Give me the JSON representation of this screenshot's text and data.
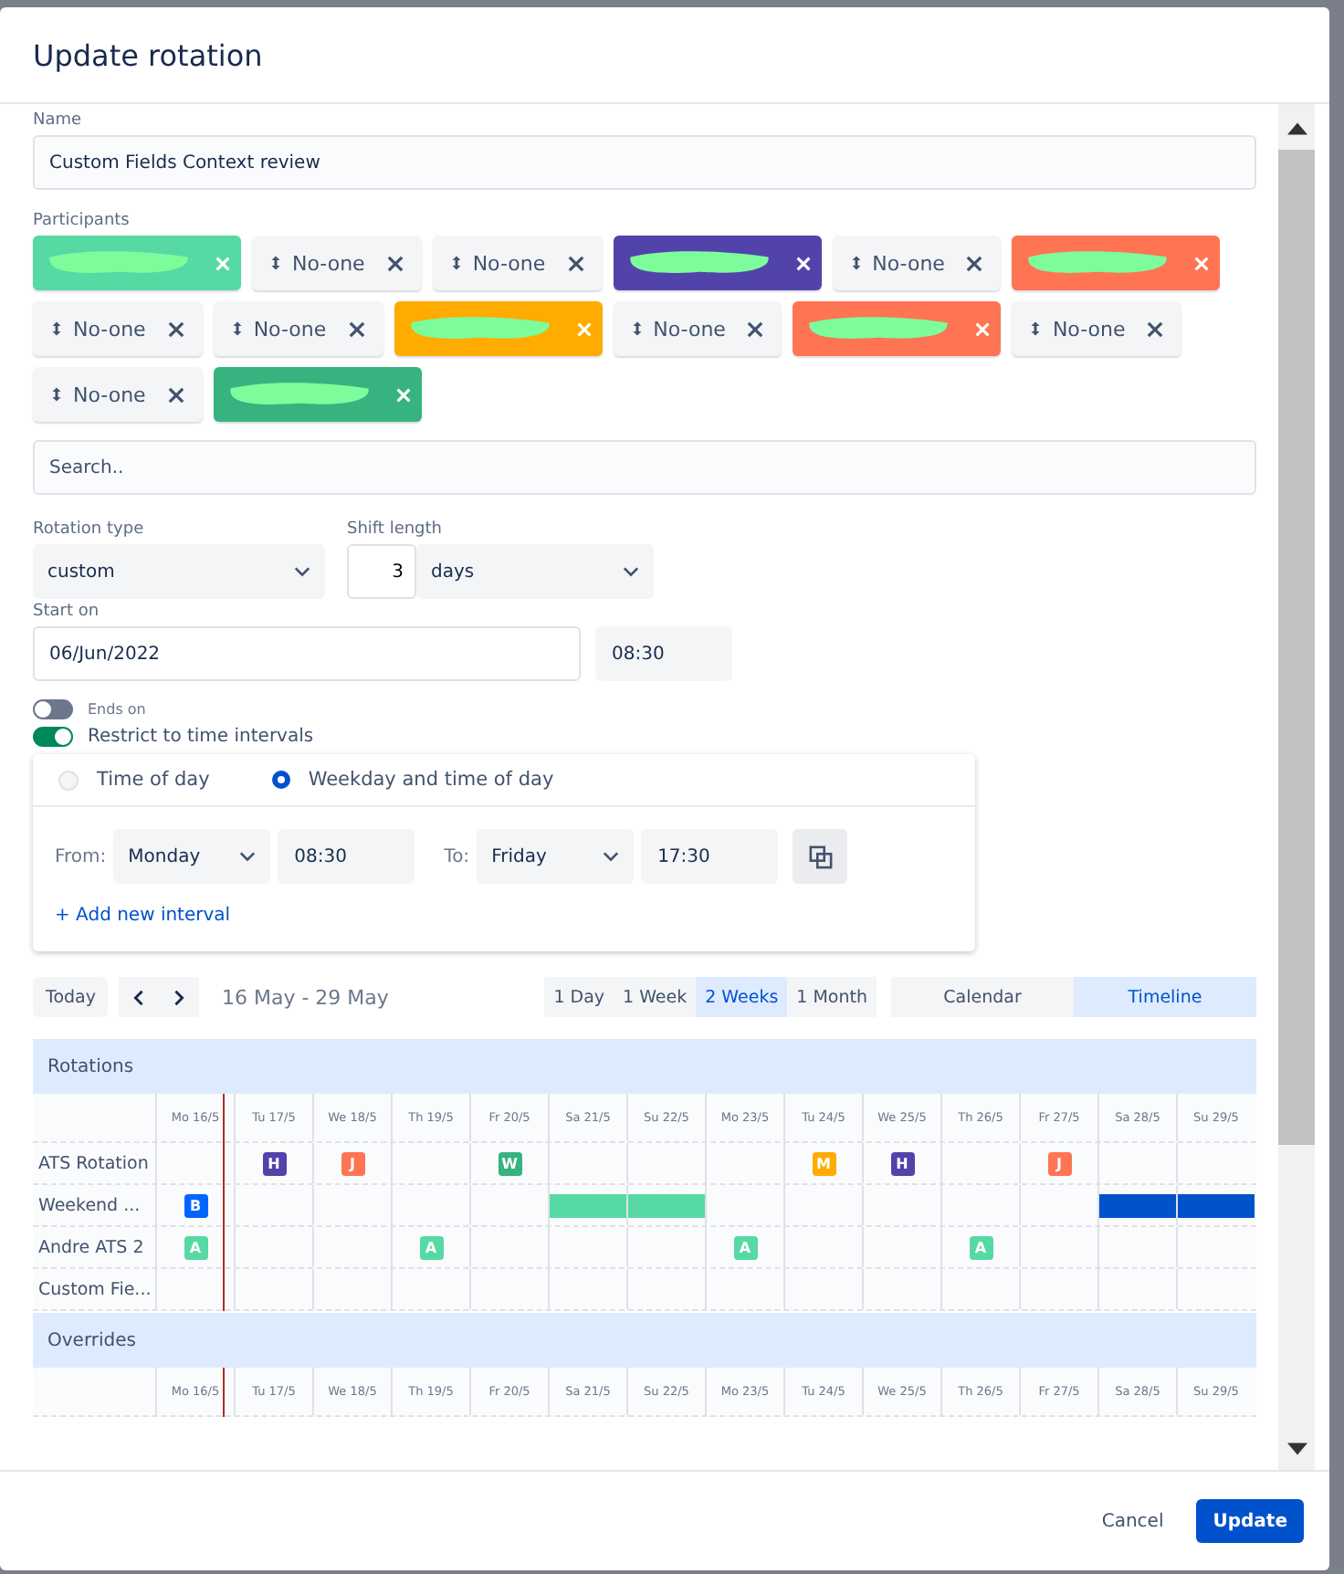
{
  "dialog": {
    "title": "Update rotation"
  },
  "name": {
    "label": "Name",
    "value": "Custom Fields Context review"
  },
  "participants": {
    "label": "Participants",
    "items": [
      {
        "kind": "redacted",
        "color": "#57d9a3"
      },
      {
        "kind": "empty",
        "label": "No-one"
      },
      {
        "kind": "empty",
        "label": "No-one"
      },
      {
        "kind": "redacted",
        "color": "#5243aa"
      },
      {
        "kind": "empty",
        "label": "No-one"
      },
      {
        "kind": "redacted",
        "color": "#ff7452"
      },
      {
        "kind": "empty",
        "label": "No-one"
      },
      {
        "kind": "empty",
        "label": "No-one"
      },
      {
        "kind": "redacted",
        "color": "#ffab00"
      },
      {
        "kind": "empty",
        "label": "No-one"
      },
      {
        "kind": "redacted",
        "color": "#ff7452"
      },
      {
        "kind": "empty",
        "label": "No-one"
      },
      {
        "kind": "empty",
        "label": "No-one"
      },
      {
        "kind": "redacted",
        "color": "#36b37e"
      }
    ],
    "search_placeholder": "Search.."
  },
  "rotation_type": {
    "label": "Rotation type",
    "value": "custom"
  },
  "shift_length": {
    "label": "Shift length",
    "count": "3",
    "unit": "days"
  },
  "start_on": {
    "label": "Start on",
    "date": "06/Jun/2022",
    "time": "08:30"
  },
  "ends_on": {
    "label": "Ends on",
    "on": false
  },
  "restrict": {
    "label": "Restrict to time intervals",
    "on": true,
    "modes": [
      {
        "label": "Time of day",
        "selected": false
      },
      {
        "label": "Weekday and time of day",
        "selected": true
      }
    ],
    "interval": {
      "from_label": "From:",
      "from_day": "Monday",
      "from_time": "08:30",
      "to_label": "To:",
      "to_day": "Friday",
      "to_time": "17:30"
    },
    "add_link": "+ Add new interval"
  },
  "calendar": {
    "today": "Today",
    "range": "16 May - 29 May",
    "spans": [
      {
        "label": "1 Day",
        "selected": false
      },
      {
        "label": "1 Week",
        "selected": false
      },
      {
        "label": "2 Weeks",
        "selected": true
      },
      {
        "label": "1 Month",
        "selected": false
      }
    ],
    "views": [
      {
        "label": "Calendar",
        "selected": false
      },
      {
        "label": "Timeline",
        "selected": true
      }
    ],
    "days": [
      "Mo 16/5",
      "Tu 17/5",
      "We 18/5",
      "Th 19/5",
      "Fr 20/5",
      "Sa 21/5",
      "Su 22/5",
      "Mo 23/5",
      "Tu 24/5",
      "We 25/5",
      "Th 26/5",
      "Fr 27/5",
      "Sa 28/5",
      "Su 29/5"
    ],
    "rotations_title": "Rotations",
    "rows": [
      {
        "name": "ATS Rotation",
        "cells": [
          {
            "kind": "empty"
          },
          {
            "kind": "badge",
            "letter": "H",
            "color": "#5243aa"
          },
          {
            "kind": "badge",
            "letter": "J",
            "color": "#ff7452"
          },
          {
            "kind": "empty"
          },
          {
            "kind": "badge",
            "letter": "W",
            "color": "#36b37e"
          },
          {
            "kind": "empty"
          },
          {
            "kind": "empty"
          },
          {
            "kind": "empty"
          },
          {
            "kind": "badge",
            "letter": "M",
            "color": "#ffab00"
          },
          {
            "kind": "badge",
            "letter": "H",
            "color": "#5243aa"
          },
          {
            "kind": "empty"
          },
          {
            "kind": "badge",
            "letter": "J",
            "color": "#ff7452"
          },
          {
            "kind": "empty"
          },
          {
            "kind": "empty"
          }
        ]
      },
      {
        "name": "Weekend ...",
        "cells": [
          {
            "kind": "badge",
            "letter": "B",
            "color": "#0065ff"
          },
          {
            "kind": "empty"
          },
          {
            "kind": "empty"
          },
          {
            "kind": "empty"
          },
          {
            "kind": "empty"
          },
          {
            "kind": "bar",
            "color": "#57d9a3"
          },
          {
            "kind": "bar",
            "color": "#57d9a3"
          },
          {
            "kind": "empty"
          },
          {
            "kind": "empty"
          },
          {
            "kind": "empty"
          },
          {
            "kind": "empty"
          },
          {
            "kind": "empty"
          },
          {
            "kind": "bar",
            "color": "#0052cc"
          },
          {
            "kind": "bar",
            "color": "#0052cc"
          }
        ]
      },
      {
        "name": "Andre ATS 2",
        "cells": [
          {
            "kind": "badge",
            "letter": "A",
            "color": "#57d9a3"
          },
          {
            "kind": "empty"
          },
          {
            "kind": "empty"
          },
          {
            "kind": "badge",
            "letter": "A",
            "color": "#57d9a3"
          },
          {
            "kind": "empty"
          },
          {
            "kind": "empty"
          },
          {
            "kind": "empty"
          },
          {
            "kind": "badge",
            "letter": "A",
            "color": "#57d9a3"
          },
          {
            "kind": "empty"
          },
          {
            "kind": "empty"
          },
          {
            "kind": "badge",
            "letter": "A",
            "color": "#57d9a3"
          },
          {
            "kind": "empty"
          },
          {
            "kind": "empty"
          },
          {
            "kind": "empty"
          }
        ]
      },
      {
        "name": "Custom Fie...",
        "cells": [
          {
            "kind": "empty"
          },
          {
            "kind": "empty"
          },
          {
            "kind": "empty"
          },
          {
            "kind": "empty"
          },
          {
            "kind": "empty"
          },
          {
            "kind": "empty"
          },
          {
            "kind": "empty"
          },
          {
            "kind": "empty"
          },
          {
            "kind": "empty"
          },
          {
            "kind": "empty"
          },
          {
            "kind": "empty"
          },
          {
            "kind": "empty"
          },
          {
            "kind": "empty"
          },
          {
            "kind": "empty"
          }
        ]
      }
    ],
    "overrides_title": "Overrides",
    "overrides_days": [
      "Mo 16/5",
      "Tu 17/5",
      "We 18/5",
      "Th 19/5",
      "Fr 20/5",
      "Sa 21/5",
      "Su 22/5",
      "Mo 23/5",
      "Tu 24/5",
      "We 25/5",
      "Th 26/5",
      "Fr 27/5",
      "Sa 28/5",
      "Su 29/5"
    ]
  },
  "footer": {
    "cancel": "Cancel",
    "submit": "Update"
  }
}
